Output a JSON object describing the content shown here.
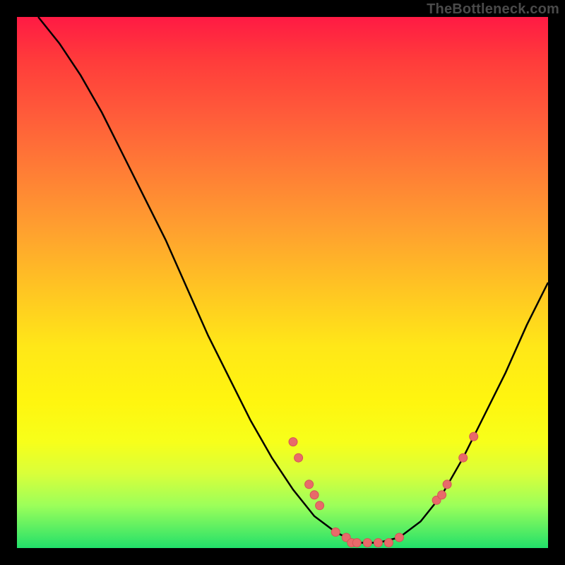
{
  "watermark": "TheBottleneck.com",
  "chart_data": {
    "type": "line",
    "title": "",
    "xlabel": "",
    "ylabel": "",
    "xlim": [
      0,
      100
    ],
    "ylim": [
      0,
      100
    ],
    "grid": false,
    "legend": false,
    "series": [
      {
        "name": "bottleneck-curve",
        "x": [
          4,
          8,
          12,
          16,
          20,
          24,
          28,
          32,
          36,
          40,
          44,
          48,
          52,
          56,
          60,
          62,
          64,
          68,
          72,
          76,
          80,
          84,
          88,
          92,
          96,
          100
        ],
        "y": [
          100,
          95,
          89,
          82,
          74,
          66,
          58,
          49,
          40,
          32,
          24,
          17,
          11,
          6,
          3,
          2,
          1,
          1,
          2,
          5,
          10,
          17,
          25,
          33,
          42,
          50
        ]
      }
    ],
    "points": [
      {
        "x": 52,
        "y": 20
      },
      {
        "x": 53,
        "y": 17
      },
      {
        "x": 55,
        "y": 12
      },
      {
        "x": 56,
        "y": 10
      },
      {
        "x": 57,
        "y": 8
      },
      {
        "x": 60,
        "y": 3
      },
      {
        "x": 62,
        "y": 2
      },
      {
        "x": 63,
        "y": 1
      },
      {
        "x": 64,
        "y": 1
      },
      {
        "x": 66,
        "y": 1
      },
      {
        "x": 68,
        "y": 1
      },
      {
        "x": 70,
        "y": 1
      },
      {
        "x": 72,
        "y": 2
      },
      {
        "x": 79,
        "y": 9
      },
      {
        "x": 80,
        "y": 10
      },
      {
        "x": 81,
        "y": 12
      },
      {
        "x": 84,
        "y": 17
      },
      {
        "x": 86,
        "y": 21
      }
    ],
    "background_gradient": {
      "top": "#ff1a44",
      "upper_mid": "#ffa02f",
      "mid": "#ffe718",
      "lower_mid": "#d9ff3a",
      "bottom": "#22e06a"
    }
  }
}
